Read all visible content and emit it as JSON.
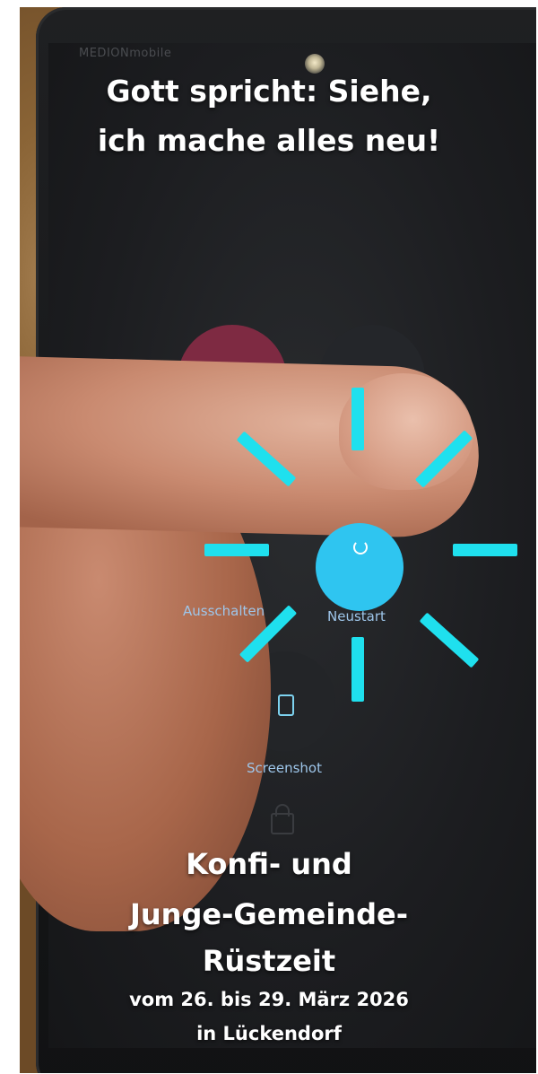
{
  "headline": {
    "line1": "Gott spricht: Siehe,",
    "line2": "ich mache alles neu!"
  },
  "phone_screen": {
    "carrier": "MEDIONmobile",
    "buttons": {
      "power_off_label": "Ausschalten",
      "restart_label": "Neustart",
      "screenshot_label": "Screenshot"
    }
  },
  "event": {
    "line1": "Konfi- und",
    "line2": "Junge-Gemeinde-",
    "line3": "Rüstzeit",
    "dates": "vom 26. bis 29. März 2026",
    "location": "in Lückendorf"
  },
  "colors": {
    "accent_cyan": "#1fe0ee",
    "restart_button": "#2fc5f0",
    "power_button": "#7e2a42",
    "text": "#ffffff"
  }
}
